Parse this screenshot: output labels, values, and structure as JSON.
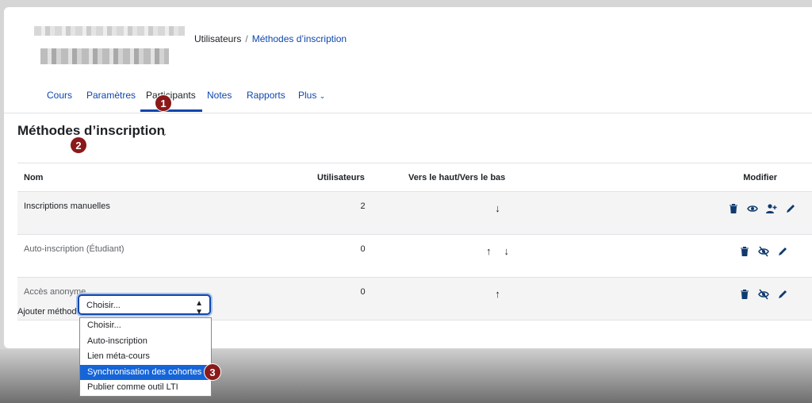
{
  "breadcrumb": {
    "item1": "Utilisateurs",
    "separator": "/",
    "item2": "Méthodes d’inscription"
  },
  "nav": {
    "items": [
      "Cours",
      "Paramètres",
      "Participants",
      "Notes",
      "Rapports",
      "Plus"
    ],
    "active": "Participants"
  },
  "page": {
    "title": "Méthodes d’inscription"
  },
  "badges": [
    "1",
    "2",
    "3"
  ],
  "table": {
    "headers": [
      "Nom",
      "Utilisateurs",
      "Vers le haut/Vers le bas",
      "Modifier"
    ],
    "rows": [
      {
        "name": "Inscriptions manuelles",
        "users": "2",
        "arrows": [
          "down-arrow"
        ],
        "icons": [
          "trash-icon",
          "eye-icon",
          "add-user-icon",
          "pencil-icon"
        ]
      },
      {
        "name": "Auto-inscription (Étudiant)",
        "users": "0",
        "arrows": [
          "up-arrow",
          "down-arrow"
        ],
        "icons": [
          "trash-icon",
          "eye-slash-icon",
          "pencil-icon"
        ]
      },
      {
        "name": "Accès anonyme",
        "users": "0",
        "arrows": [
          "up-arrow"
        ],
        "icons": [
          "trash-icon",
          "eye-slash-icon",
          "pencil-icon"
        ]
      }
    ]
  },
  "add_method": {
    "label": "Ajouter méthode",
    "value": "Choisir...",
    "options": [
      "Choisir...",
      "Auto-inscription",
      "Lien méta-cours",
      "Synchronisation des cohortes",
      "Publier comme outil LTI"
    ],
    "highlighted": "Synchronisation des cohortes"
  },
  "colors": {
    "link": "#0f47ad",
    "badge": "#8b1919",
    "highlight": "#1565d8"
  }
}
